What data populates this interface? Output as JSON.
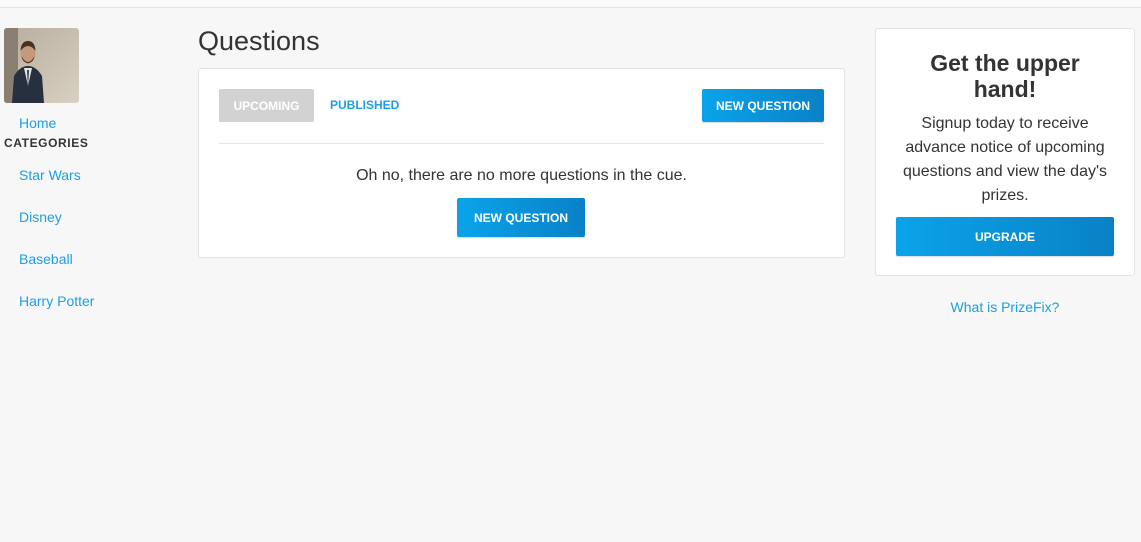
{
  "sidebar": {
    "home_label": "Home",
    "categories_heading": "CATEGORIES",
    "categories": [
      {
        "label": "Star Wars"
      },
      {
        "label": "Disney"
      },
      {
        "label": "Baseball"
      },
      {
        "label": "Harry Potter"
      }
    ]
  },
  "main": {
    "title": "Questions",
    "tabs": [
      {
        "label": "UPCOMING",
        "active": true
      },
      {
        "label": "PUBLISHED",
        "active": false
      }
    ],
    "new_question_label": "NEW QUESTION",
    "empty_message": "Oh no, there are no more questions in the cue.",
    "empty_new_question_label": "NEW QUESTION"
  },
  "promo": {
    "title": "Get the upper hand!",
    "text": "Signup today to receive advance notice of upcoming questions and view the day's prizes.",
    "upgrade_label": "UPGRADE",
    "link_label": "What is PrizeFix?"
  },
  "colors": {
    "accent": "#1ba0e2",
    "button_gradient_start": "#0aa3ea",
    "button_gradient_end": "#0a81c6",
    "tab_inactive_bg": "#d2d2d2",
    "page_bg": "#f7f7f7"
  }
}
